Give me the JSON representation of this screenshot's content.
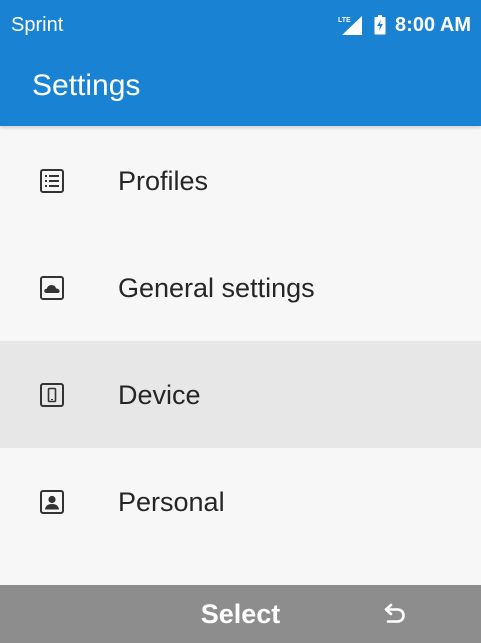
{
  "status_bar": {
    "carrier": "Sprint",
    "network_type": "LTE",
    "time": "8:00 AM",
    "signal_icon": "signal-icon",
    "battery_icon": "battery-icon"
  },
  "app_bar": {
    "title": "Settings"
  },
  "settings": {
    "items": [
      {
        "label": "Profiles",
        "icon": "list-icon",
        "selected": false
      },
      {
        "label": "General settings",
        "icon": "cloud-icon",
        "selected": false
      },
      {
        "label": "Device",
        "icon": "phone-icon",
        "selected": true
      },
      {
        "label": "Personal",
        "icon": "person-icon",
        "selected": false
      }
    ]
  },
  "softkeys": {
    "center_label": "Select",
    "right_icon": "back-icon"
  },
  "colors": {
    "primary": "#1a82d2",
    "selected_row": "#e7e7e7",
    "softkey_bar": "#8d8d8d",
    "background": "#f7f7f7"
  }
}
